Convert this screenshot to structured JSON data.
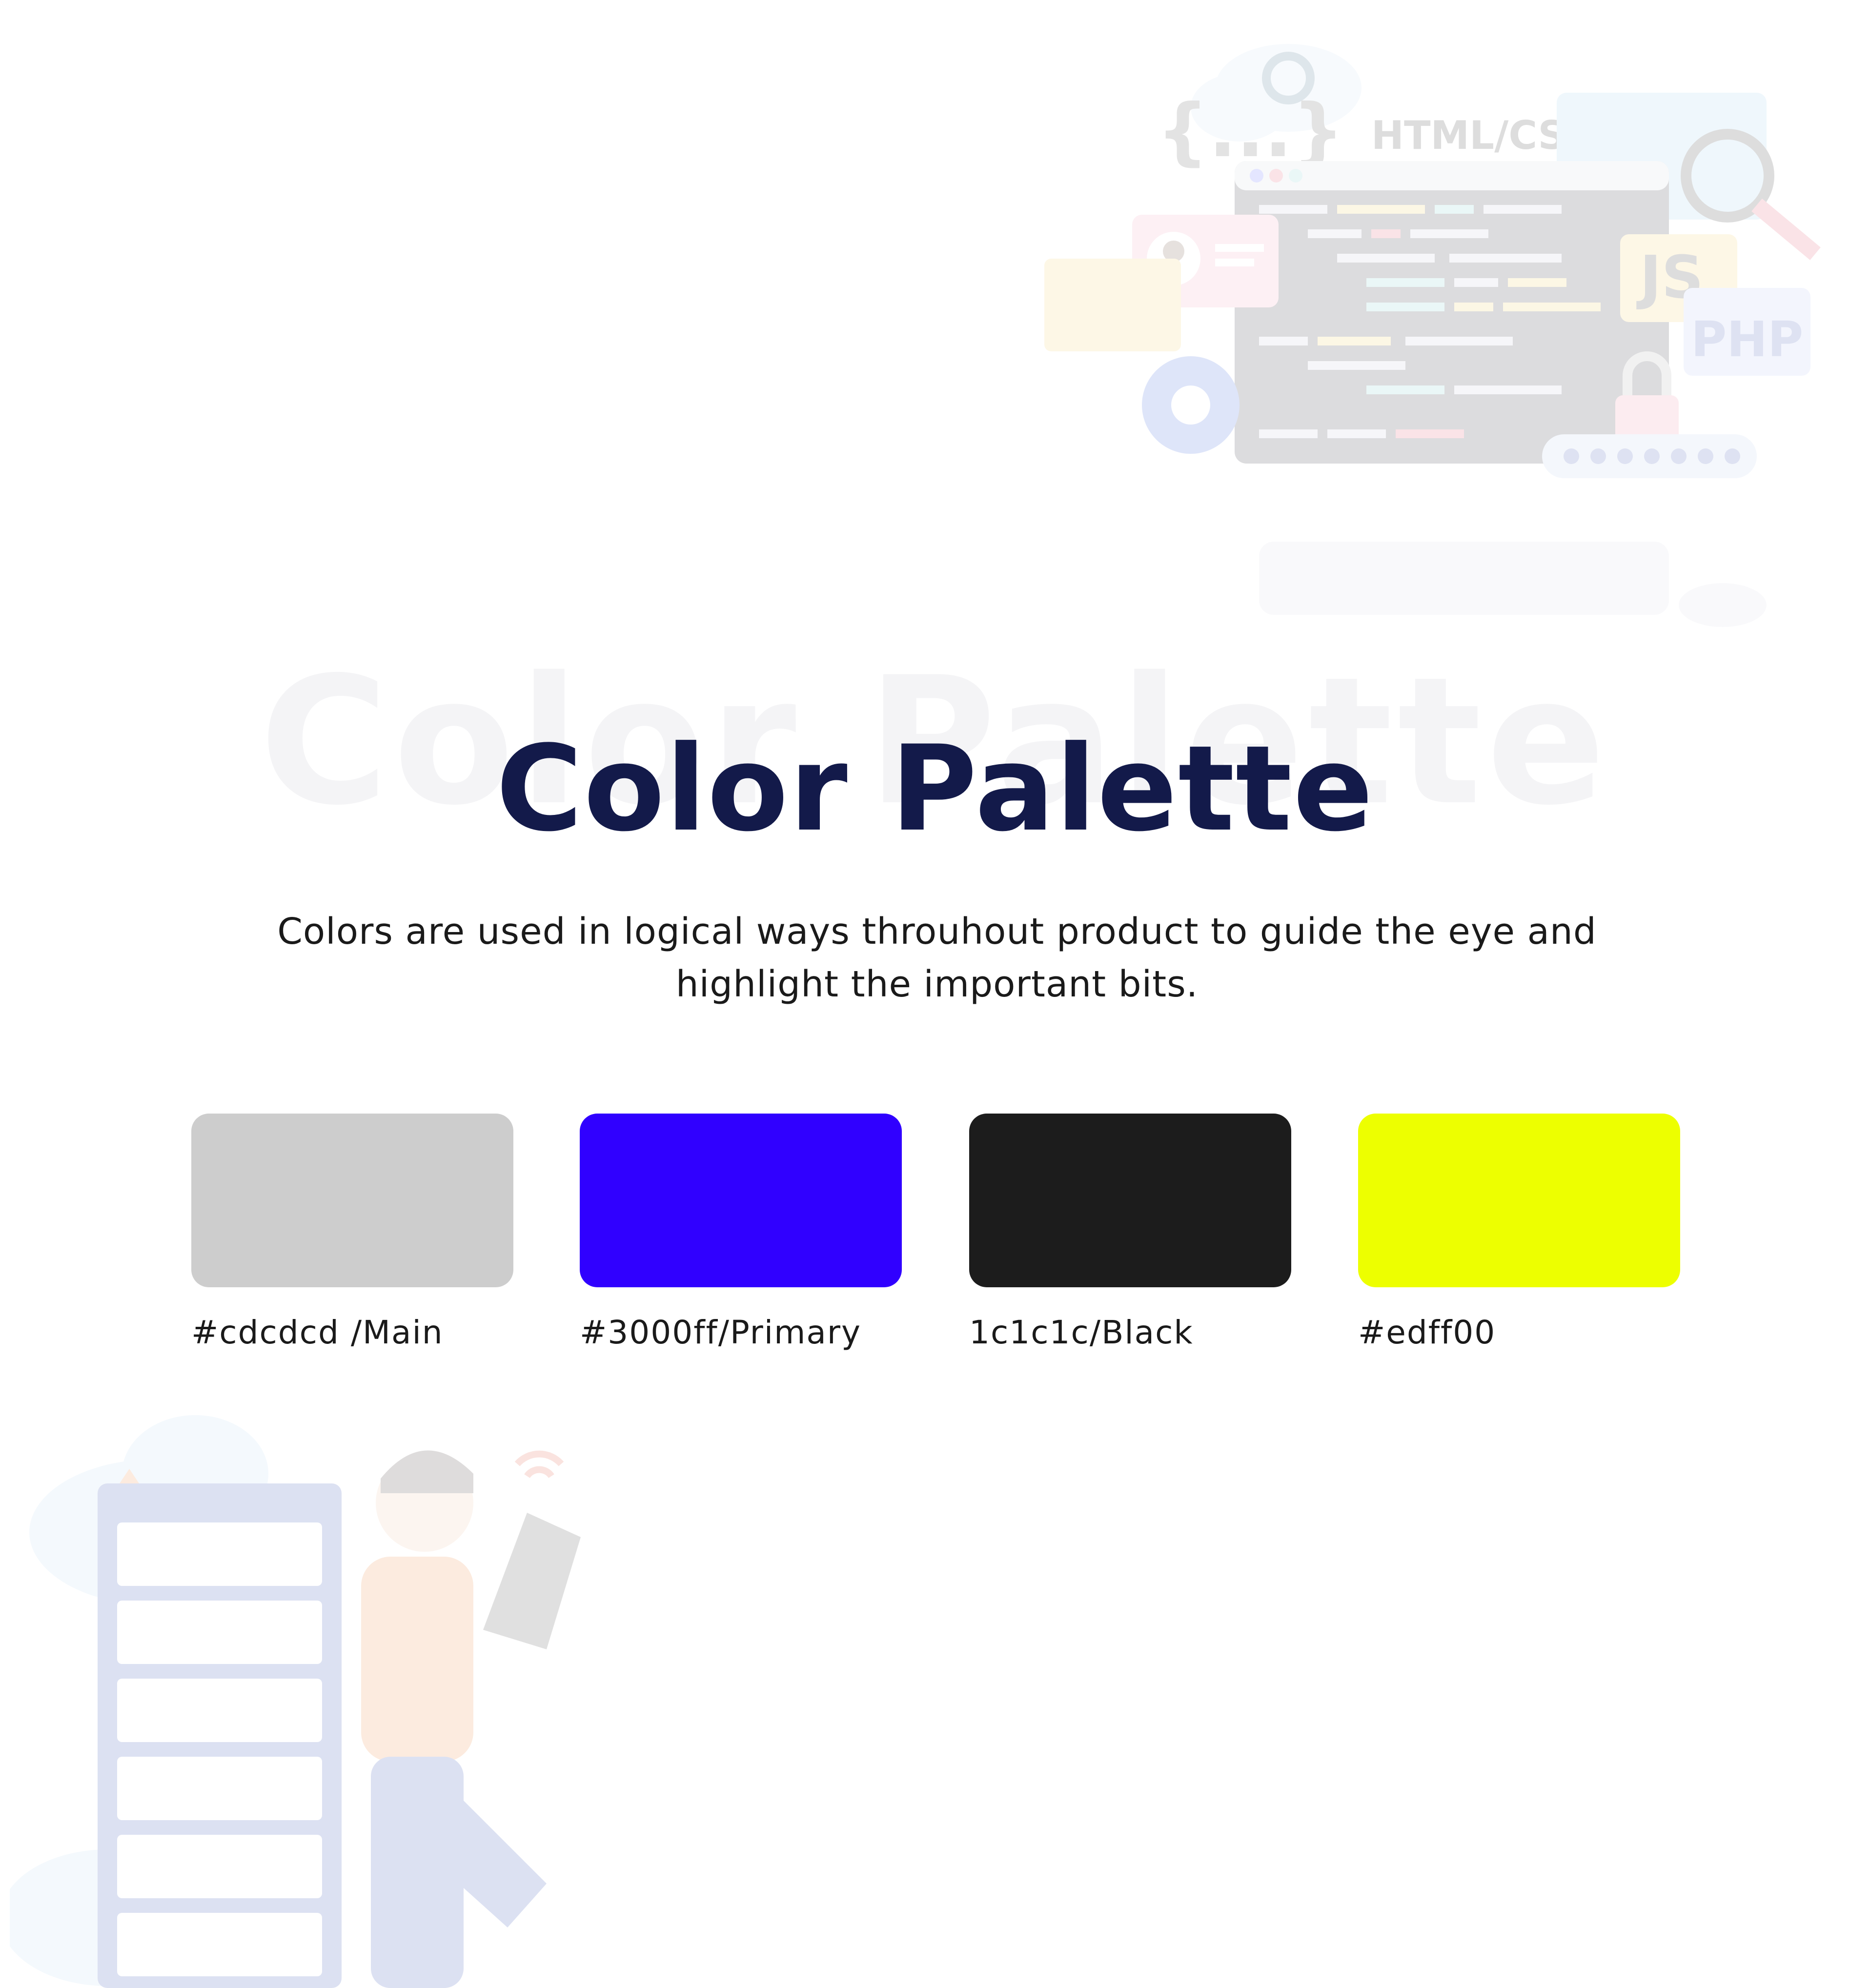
{
  "heading": {
    "background_text": "Color Palette",
    "title": "Color Palette",
    "description": "Colors are used in logical ways throuhout product to guide the eye and highlight the important bits."
  },
  "swatches": [
    {
      "color": "#cdcdcd",
      "label": "#cdcdcd /Main"
    },
    {
      "color": "#3000ff",
      "label": "#3000ff/Primary"
    },
    {
      "color": "#1c1c1c",
      "label": "1c1c1c/Black"
    },
    {
      "color": "#edff00",
      "label": "#edff00"
    }
  ],
  "illustrations": {
    "dev_code_labels": [
      "{...}",
      "HTML/CSS",
      "JS",
      "PHP"
    ]
  },
  "colors": {
    "title": "#131a4a",
    "background_title": "#f4f4f6",
    "body_text": "#1a1a1a"
  }
}
